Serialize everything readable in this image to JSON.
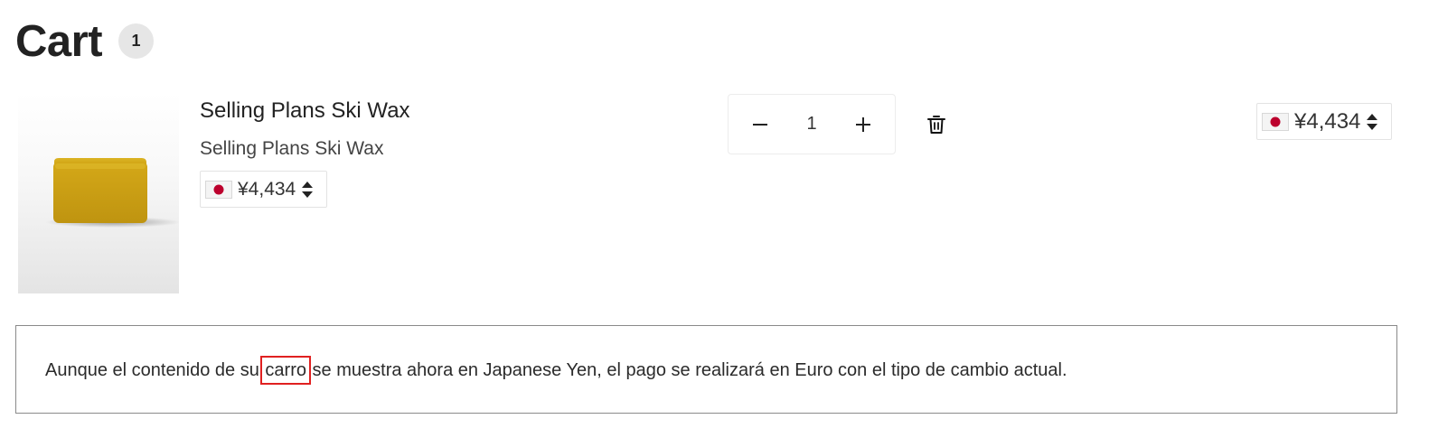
{
  "header": {
    "title": "Cart",
    "item_count": "1"
  },
  "line_item": {
    "title": "Selling Plans Ski Wax",
    "variant": "Selling Plans Ski Wax",
    "unit_price": {
      "currency_symbol": "¥",
      "amount": "¥4,434",
      "flag": "japan-flag-icon"
    },
    "quantity": "1",
    "line_total": {
      "amount": "¥4,434",
      "flag": "japan-flag-icon"
    },
    "image_icon": "ski-wax-bar"
  },
  "notice": {
    "before": "Aunque el contenido de su ",
    "highlighted": "carro",
    "after": " se muestra ahora en Japanese Yen, el pago se realizará en Euro con el tipo de cambio actual."
  },
  "colors": {
    "highlight_border": "#e02020",
    "wax": "#d4a81a",
    "flag_red": "#bc002d"
  }
}
